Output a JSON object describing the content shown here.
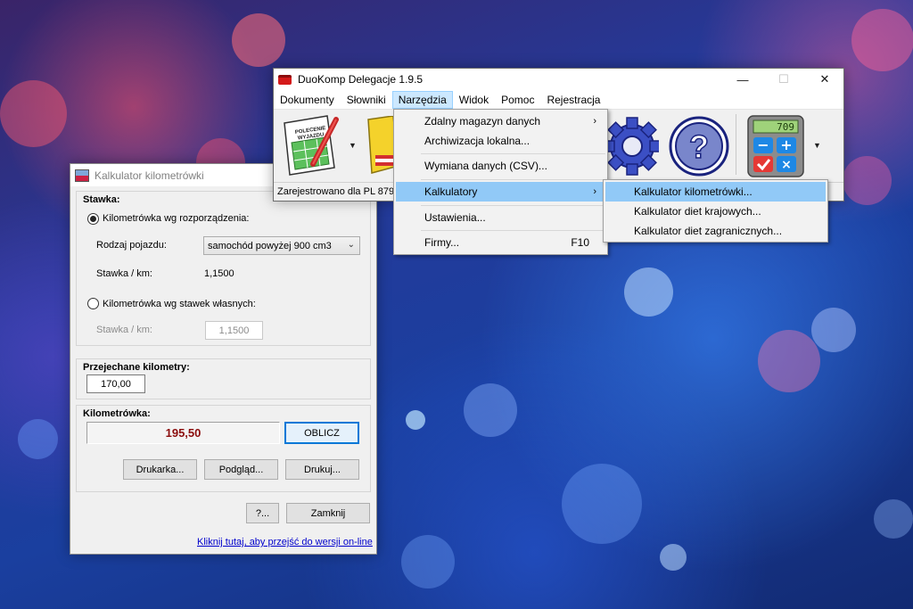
{
  "calculator": {
    "title": "Kalkulator kilometrówki",
    "rate_group_title": "Stawka:",
    "radio_official_label": "Kilometrówka wg rozporządzenia:",
    "radio_official_selected": true,
    "vehicle_type_label": "Rodzaj pojazdu:",
    "vehicle_type_value": "samochód powyżej 900 cm3",
    "rate_label": "Stawka / km:",
    "rate_value": "1,1500",
    "radio_own_label": "Kilometrówka wg stawek własnych:",
    "radio_own_selected": false,
    "own_rate_label": "Stawka / km:",
    "own_rate_value": "1,1500",
    "km_group_title": "Przejechane kilometry:",
    "km_value": "170,00",
    "result_group_title": "Kilometrówka:",
    "result_value": "195,50",
    "compute_button": "OBLICZ",
    "printer_button": "Drukarka...",
    "preview_button": "Podgląd...",
    "print_button": "Drukuj...",
    "help_button": "?...",
    "close_button": "Zamknij",
    "online_link": "Kliknij tutaj, aby przejść do wersji on-line"
  },
  "main_window": {
    "title": "DuoKomp Delegacje 1.9.5",
    "menu": [
      "Dokumenty",
      "Słowniki",
      "Narzędzia",
      "Widok",
      "Pomoc",
      "Rejestracja"
    ],
    "active_menu": "Narzędzia",
    "toolbar_doc_label_1": "POLECENIE",
    "toolbar_doc_label_2": "WYJAZDU",
    "calc_display": "709",
    "status": "Zarejestrowano dla PL 879",
    "controls": {
      "minimize": "—",
      "maximize": "☐",
      "close": "✕"
    }
  },
  "tools_menu": {
    "items": [
      {
        "label": "Zdalny magazyn danych",
        "submenu": true
      },
      {
        "label": "Archiwizacja lokalna...",
        "submenu": false
      },
      {
        "label": "Wymiana danych (CSV)...",
        "submenu": false
      },
      {
        "label": "Kalkulatory",
        "submenu": true,
        "highlighted": true
      },
      {
        "label": "Ustawienia...",
        "submenu": false
      },
      {
        "label": "Firmy...",
        "shortcut": "F10"
      }
    ]
  },
  "calculators_submenu": {
    "items": [
      {
        "label": "Kalkulator kilometrówki...",
        "highlighted": true
      },
      {
        "label": "Kalkulator diet krajowych..."
      },
      {
        "label": "Kalkulator diet zagranicznych..."
      }
    ]
  },
  "colors": {
    "result_text": "#8b0d0d",
    "menu_highlight": "#91c9f7",
    "default_button_border": "#0078d7",
    "link": "#0000cc"
  }
}
